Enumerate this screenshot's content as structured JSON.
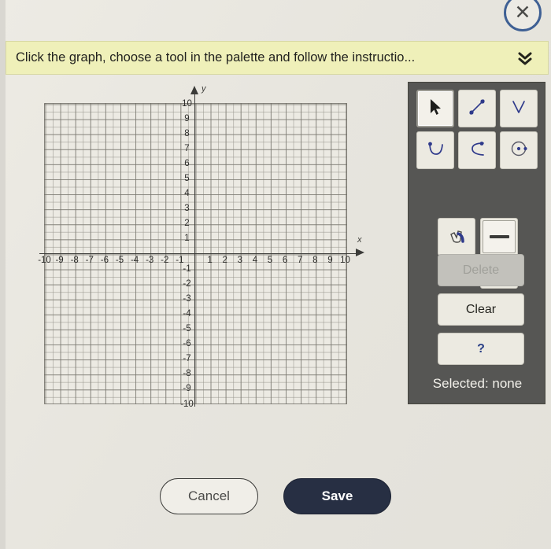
{
  "window": {
    "close_icon": "close-circle-icon"
  },
  "banner": {
    "text": "Click the graph, choose a tool in the palette and follow the instructio...",
    "expand_icon": "double-chevron-down-icon",
    "background_color": "#eff0b9"
  },
  "graph": {
    "x_axis_letter": "x",
    "y_axis_letter": "y",
    "x_ticks": [
      "-10",
      "-9",
      "-8",
      "-7",
      "-6",
      "-5",
      "-4",
      "-3",
      "-2",
      "-1",
      "1",
      "2",
      "3",
      "4",
      "5",
      "6",
      "7",
      "8",
      "9",
      "10"
    ],
    "y_ticks": [
      "10",
      "9",
      "8",
      "7",
      "6",
      "5",
      "4",
      "3",
      "2",
      "1",
      "-1",
      "-2",
      "-3",
      "-4",
      "-5",
      "-6",
      "-7",
      "-8",
      "-9",
      "-10"
    ],
    "x_range": [
      -10,
      10
    ],
    "y_range": [
      -10,
      10
    ],
    "minor_grid_per_unit": 2,
    "plotted_objects": []
  },
  "palette": {
    "tools": [
      {
        "name": "pointer-tool",
        "icon": "arrow-cursor-icon",
        "selected": true
      },
      {
        "name": "line-tool",
        "icon": "line-segment-icon",
        "selected": false
      },
      {
        "name": "absolute-value-tool",
        "icon": "v-shape-icon",
        "selected": false
      },
      {
        "name": "parabola-tool",
        "icon": "u-parabola-icon",
        "selected": false
      },
      {
        "name": "sideways-parabola-tool",
        "icon": "c-parabola-icon",
        "selected": false
      },
      {
        "name": "circle-tool",
        "icon": "circle-with-center-icon",
        "selected": false
      },
      {
        "name": "drag-tool",
        "icon": "hand-drag-icon",
        "selected": false
      }
    ],
    "line_styles": [
      {
        "name": "solid-line-style",
        "icon": "solid-line-icon",
        "selected": true
      },
      {
        "name": "dashed-line-style",
        "icon": "dashed-line-icon",
        "selected": false
      }
    ],
    "delete_label": "Delete",
    "delete_enabled": false,
    "clear_label": "Clear",
    "help_label": "?",
    "selected_status": "Selected: none",
    "panel_color": "#565654"
  },
  "footer": {
    "cancel_label": "Cancel",
    "save_label": "Save",
    "save_color": "#272f43"
  }
}
